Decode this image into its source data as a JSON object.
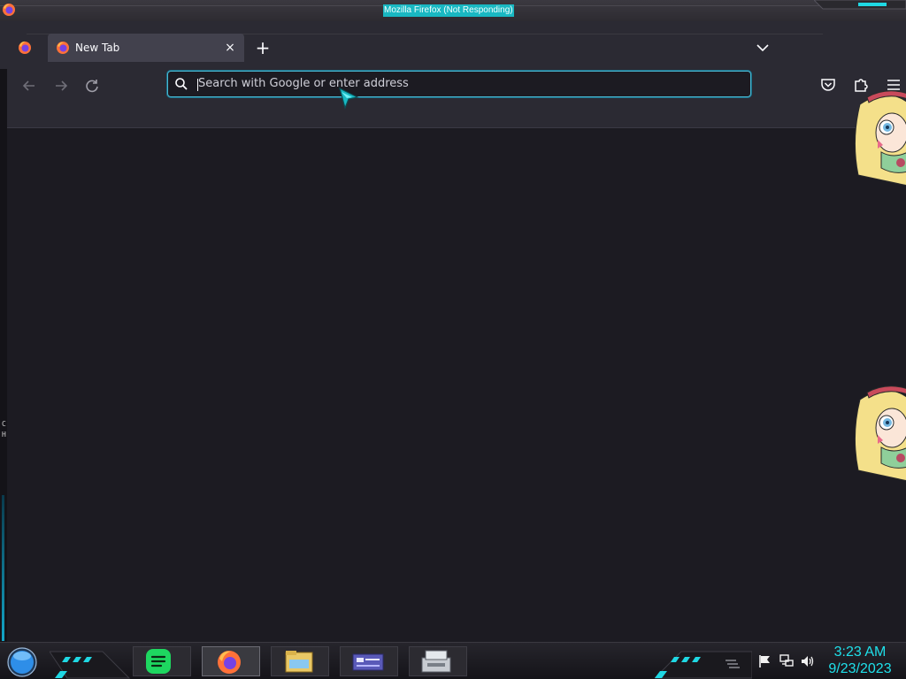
{
  "window": {
    "title": "Mozilla Firefox (Not Responding)"
  },
  "tabs": [
    {
      "title": "New Tab",
      "active": true
    }
  ],
  "toolbar": {
    "new_tab_symbol": "+",
    "close_tab_symbol": "×"
  },
  "urlbar": {
    "placeholder": "Search with Google or enter address",
    "value": ""
  },
  "taskbar": {
    "apps": [
      "spotify-icon",
      "firefox-icon",
      "file-explorer-icon",
      "control-panel-icon",
      "disk-utility-icon"
    ],
    "active_app": "firefox-icon",
    "clock": {
      "time": "3:23 AM",
      "date": "9/23/2023"
    }
  },
  "colors": {
    "accent": "#19b8c2",
    "clock": "#1fe0ea",
    "browser_bg": "#1c1b22",
    "toolbar_bg": "#2b2a33",
    "urlbar_focus": "#4bb8d2"
  }
}
